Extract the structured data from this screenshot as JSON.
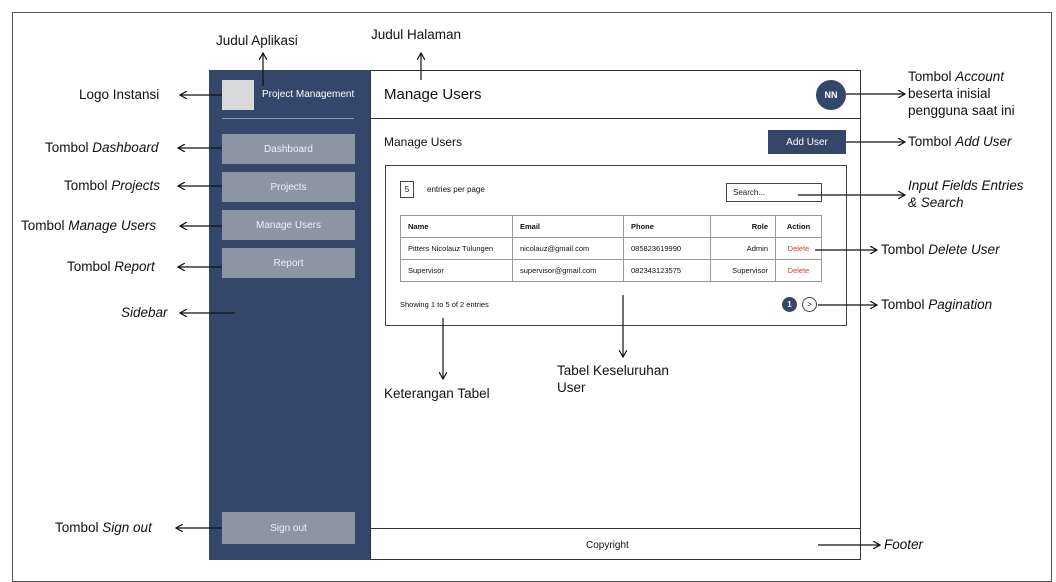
{
  "annotations": {
    "judul_aplikasi": "Judul Aplikasi",
    "judul_halaman": "Judul Halaman",
    "logo_instansi": "Logo Instansi",
    "tombol_dashboard_a": "Tombol ",
    "tombol_dashboard_b": "Dashboard",
    "tombol_projects_a": "Tombol ",
    "tombol_projects_b": "Projects",
    "tombol_manage_users_a": "Tombol ",
    "tombol_manage_users_b": "Manage Users",
    "tombol_report_a": "Tombol ",
    "tombol_report_b": "Report",
    "sidebar": "Sidebar",
    "tombol_sign_out_a": "Tombol ",
    "tombol_sign_out_b": "Sign out",
    "tombol_account_a": "Tombol ",
    "tombol_account_b": "Account",
    "tombol_account_line2": "beserta inisial",
    "tombol_account_line3": "pengguna saat ini",
    "tombol_add_user_a": "Tombol ",
    "tombol_add_user_b": "Add User",
    "input_fields_line1": "Input Fields Entries",
    "input_fields_line2": "& Search",
    "tombol_delete_user_a": "Tombol ",
    "tombol_delete_user_b": "Delete User",
    "tombol_pagination_a": "Tombol ",
    "tombol_pagination_b": "Pagination",
    "tabel_keseluruhan_line1": "Tabel Keseluruhan",
    "tabel_keseluruhan_line2": "User",
    "keterangan_tabel": "Keterangan Tabel",
    "footer": "Footer"
  },
  "sidebar": {
    "app_title": "Project Management",
    "items": [
      {
        "label": "Dashboard"
      },
      {
        "label": "Projects"
      },
      {
        "label": "Manage Users"
      },
      {
        "label": "Report"
      }
    ],
    "sign_out": "Sign out"
  },
  "header": {
    "title": "Manage Users",
    "avatar_initials": "NN"
  },
  "main": {
    "section_title": "Manage Users",
    "add_user_label": "Add User",
    "entries_value": "5",
    "entries_label": "entries per page",
    "search_placeholder": "Search...",
    "table": {
      "columns": [
        "Name",
        "Email",
        "Phone",
        "Role",
        "Action"
      ],
      "rows": [
        {
          "name": "Pitters Nicolauz Tulungen",
          "email": "nicolauz@gmail.com",
          "phone": "085823619990",
          "role": "Admin",
          "action": "Delete"
        },
        {
          "name": "Supervisor",
          "email": "supervisor@gmail.com",
          "phone": "082343123575",
          "role": "Supervisor",
          "action": "Delete"
        }
      ]
    },
    "showing_text": "Showing 1 to 5 of 2 entries",
    "pagination": {
      "current": "1",
      "next": ">"
    }
  },
  "footer": {
    "text": "Copyright"
  },
  "colors": {
    "sidebar_bg": "#34466a",
    "nav_button": "#8b95a3",
    "delete_text": "#e03a3a"
  }
}
